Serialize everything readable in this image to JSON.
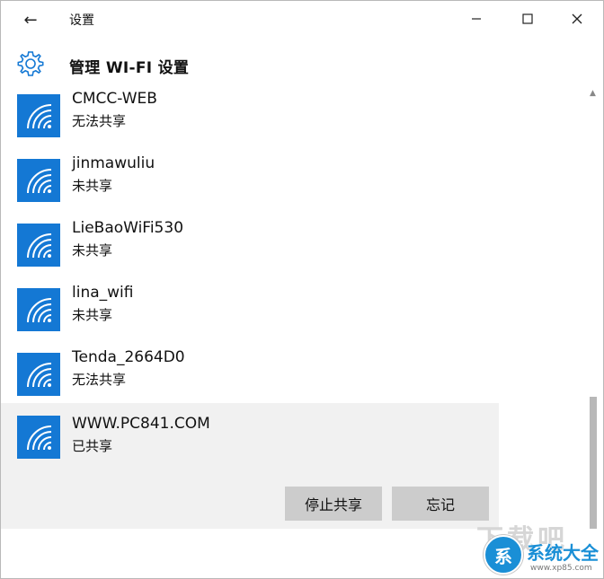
{
  "window": {
    "title": "设置",
    "back_icon": "←",
    "minimize_icon": "—",
    "maximize_icon": "☐",
    "close_icon": "✕"
  },
  "header": {
    "icon": "gear-icon",
    "title": "管理 WI-FI 设置"
  },
  "networks": [
    {
      "name": "CMCC-WEB",
      "status": "无法共享"
    },
    {
      "name": "jinmawuliu",
      "status": "未共享"
    },
    {
      "name": "LieBaoWiFi530",
      "status": "未共享"
    },
    {
      "name": "lina_wifi",
      "status": "未共享"
    },
    {
      "name": "Tenda_2664D0",
      "status": "无法共享"
    },
    {
      "name": "WWW.PC841.COM",
      "status": "已共享",
      "selected": true
    }
  ],
  "actions": {
    "stop_sharing": "停止共享",
    "forget": "忘记"
  },
  "colors": {
    "accent": "#1478d4",
    "selected_bg": "#f1f1f1",
    "button_bg": "#cccccc"
  },
  "watermark": {
    "big_text": "下载吧",
    "badge_icon": "系",
    "brand": "系统大全",
    "url": "www.xp85.com"
  }
}
